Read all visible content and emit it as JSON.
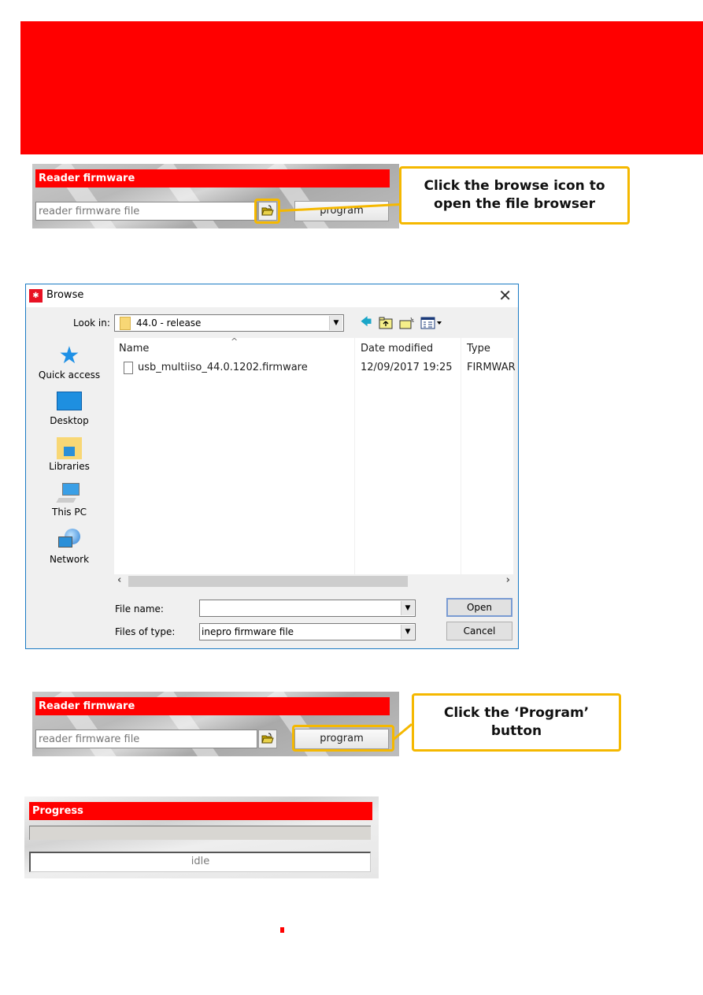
{
  "colors": {
    "accent_red": "#ff0000",
    "highlight_yellow": "#f5b800"
  },
  "step1": {
    "panel_title": "Reader firmware",
    "file_input_placeholder": "reader firmware file",
    "browse_icon": "open-folder-icon",
    "program_button": "program",
    "callout": "Click the browse icon to open the file browser"
  },
  "dialog": {
    "title": "Browse",
    "app_icon": "inepro-logo-icon",
    "close_icon": "close-icon",
    "look_in_label": "Look in:",
    "look_in_value": "44.0 - release",
    "toolbar": [
      "back-arrow-icon",
      "up-folder-icon",
      "new-folder-icon",
      "view-menu-icon"
    ],
    "places": [
      {
        "label": "Quick access",
        "icon": "star-icon"
      },
      {
        "label": "Desktop",
        "icon": "desktop-icon"
      },
      {
        "label": "Libraries",
        "icon": "libraries-icon"
      },
      {
        "label": "This PC",
        "icon": "computer-icon"
      },
      {
        "label": "Network",
        "icon": "network-icon"
      }
    ],
    "columns": [
      "Name",
      "Date modified",
      "Type"
    ],
    "files": [
      {
        "name": "usb_multiiso_44.0.1202.firmware",
        "date": "12/09/2017 19:25",
        "type": "FIRMWAR"
      }
    ],
    "file_name_label": "File name:",
    "file_name_value": "",
    "files_of_type_label": "Files of type:",
    "files_of_type_value": "inepro firmware file",
    "open_button": "Open",
    "cancel_button": "Cancel"
  },
  "step2": {
    "panel_title": "Reader firmware",
    "file_input_placeholder": "reader firmware file",
    "program_button": "program",
    "callout_line1": "Click the ‘Program’",
    "callout_line2": "button"
  },
  "progress": {
    "title": "Progress",
    "value_percent": 0,
    "status": "idle"
  }
}
